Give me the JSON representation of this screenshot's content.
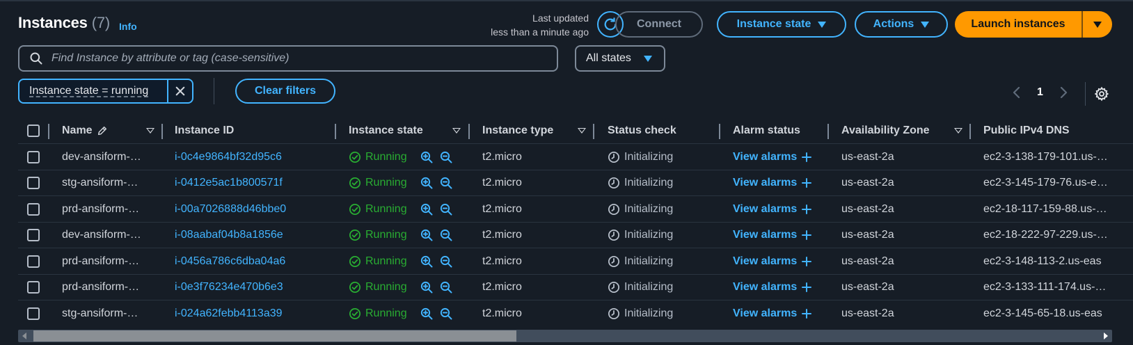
{
  "header": {
    "title": "Instances",
    "count": "(7)",
    "info": "Info",
    "last_updated_line1": "Last updated",
    "last_updated_line2": "less than a minute ago"
  },
  "toolbar": {
    "connect_label": "Connect",
    "instance_state_label": "Instance state",
    "actions_label": "Actions",
    "launch_label": "Launch instances"
  },
  "search": {
    "placeholder": "Find Instance by attribute or tag (case-sensitive)",
    "states_select": "All states"
  },
  "filters": {
    "token": "Instance state = running",
    "clear_label": "Clear filters"
  },
  "pagination": {
    "current_page": "1"
  },
  "table": {
    "columns": [
      "Name",
      "Instance ID",
      "Instance state",
      "Instance type",
      "Status check",
      "Alarm status",
      "Availability Zone",
      "Public IPv4 DNS"
    ],
    "rows": [
      {
        "name": "dev-ansiform-…",
        "id": "i-0c4e9864bf32d95c6",
        "state": "Running",
        "type": "t2.micro",
        "status": "Initializing",
        "alarm": "View alarms",
        "az": "us-east-2a",
        "dns": "ec2-3-138-179-101.us-…"
      },
      {
        "name": "stg-ansiform-…",
        "id": "i-0412e5ac1b800571f",
        "state": "Running",
        "type": "t2.micro",
        "status": "Initializing",
        "alarm": "View alarms",
        "az": "us-east-2a",
        "dns": "ec2-3-145-179-76.us-e…"
      },
      {
        "name": "prd-ansiform-…",
        "id": "i-00a7026888d46bbe0",
        "state": "Running",
        "type": "t2.micro",
        "status": "Initializing",
        "alarm": "View alarms",
        "az": "us-east-2a",
        "dns": "ec2-18-117-159-88.us-…"
      },
      {
        "name": "dev-ansiform-…",
        "id": "i-08aabaf04b8a1856e",
        "state": "Running",
        "type": "t2.micro",
        "status": "Initializing",
        "alarm": "View alarms",
        "az": "us-east-2a",
        "dns": "ec2-18-222-97-229.us-…"
      },
      {
        "name": "prd-ansiform-…",
        "id": "i-0456a786c6dba04a6",
        "state": "Running",
        "type": "t2.micro",
        "status": "Initializing",
        "alarm": "View alarms",
        "az": "us-east-2a",
        "dns": "ec2-3-148-113-2.us-eas"
      },
      {
        "name": "prd-ansiform-…",
        "id": "i-0e3f76234e470b6e3",
        "state": "Running",
        "type": "t2.micro",
        "status": "Initializing",
        "alarm": "View alarms",
        "az": "us-east-2a",
        "dns": "ec2-3-133-111-174.us-…"
      },
      {
        "name": "stg-ansiform-…",
        "id": "i-024a62febb4113a39",
        "state": "Running",
        "type": "t2.micro",
        "status": "Initializing",
        "alarm": "View alarms",
        "az": "us-east-2a",
        "dns": "ec2-3-145-65-18.us-eas"
      }
    ]
  },
  "colors": {
    "background": "#161d26",
    "link_blue": "#42b4ff",
    "launch_orange": "#ff9900",
    "running_green": "#29ad32"
  },
  "icons": [
    "search-icon",
    "refresh-icon",
    "caret-down-icon",
    "close-icon",
    "chevron-left-icon",
    "chevron-right-icon",
    "gear-icon",
    "edit-pencil-icon",
    "check-circle-icon",
    "zoom-in-icon",
    "zoom-out-icon",
    "clock-icon",
    "plus-icon"
  ]
}
